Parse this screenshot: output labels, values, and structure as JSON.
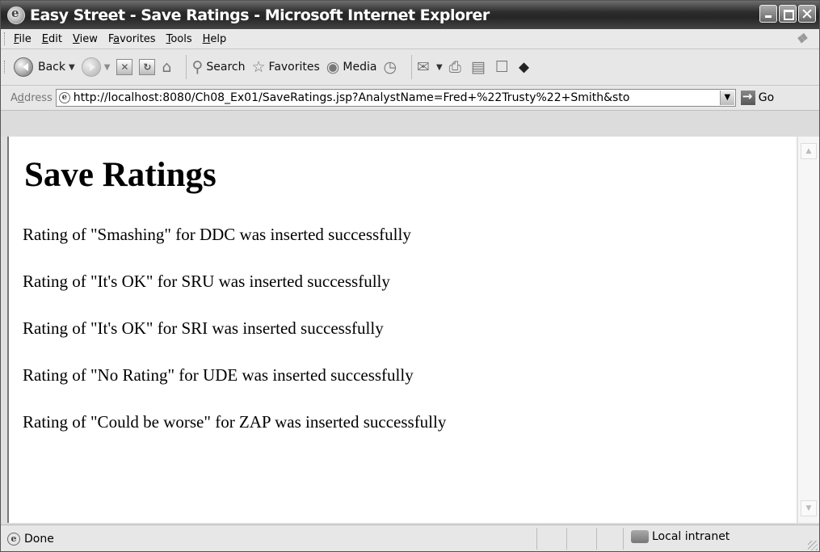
{
  "window": {
    "title": "Easy Street - Save Ratings - Microsoft Internet Explorer"
  },
  "menu": {
    "items": [
      {
        "accel": "F",
        "rest": "ile"
      },
      {
        "accel": "E",
        "rest": "dit"
      },
      {
        "accel": "V",
        "rest": "iew"
      },
      {
        "pre": "F",
        "accel": "a",
        "rest": "vorites"
      },
      {
        "accel": "T",
        "rest": "ools"
      },
      {
        "accel": "H",
        "rest": "elp"
      }
    ]
  },
  "toolbar": {
    "back_label": "Back",
    "search_label": "Search",
    "favorites_label": "Favorites",
    "media_label": "Media"
  },
  "address": {
    "label_accel": "d",
    "label_pre": "A",
    "label_rest": "dress",
    "url": "http://localhost:8080/Ch08_Ex01/SaveRatings.jsp?AnalystName=Fred+%22Trusty%22+Smith&sto",
    "go_label": "Go"
  },
  "page": {
    "heading": "Save Ratings",
    "messages": [
      "Rating of \"Smashing\" for DDC was inserted successfully",
      "Rating of \"It's OK\" for SRU was inserted successfully",
      "Rating of \"It's OK\" for SRI was inserted successfully",
      "Rating of \"No Rating\" for UDE was inserted successfully",
      "Rating of \"Could be worse\" for ZAP was inserted successfully"
    ]
  },
  "status": {
    "text": "Done",
    "zone": "Local intranet"
  }
}
